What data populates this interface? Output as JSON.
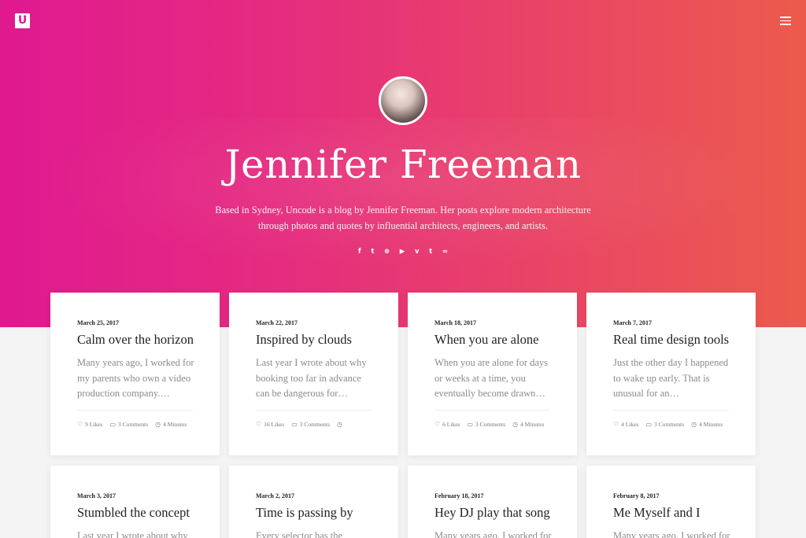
{
  "site": {
    "logo_letter": "U",
    "accent": "#e0198f",
    "gradient_end": "#ec5a4c"
  },
  "hero": {
    "name": "Jennifer Freeman",
    "bio_line1": "Based in Sydney, Uncode is a blog by Jennifer Freeman. Her posts explore modern architecture",
    "bio_line2": "through photos and quotes by influential architects, engineers, and artists.",
    "socials": [
      {
        "glyph": "f",
        "icon": "facebook-icon"
      },
      {
        "glyph": "t",
        "icon": "twitter-icon"
      },
      {
        "glyph": "⊛",
        "icon": "dribbble-icon"
      },
      {
        "glyph": "▶",
        "icon": "youtube-icon"
      },
      {
        "glyph": "v",
        "icon": "vimeo-icon"
      },
      {
        "glyph": "t",
        "icon": "tumblr-icon"
      },
      {
        "glyph": "∞",
        "icon": "link-icon"
      }
    ]
  },
  "posts": [
    {
      "date": "March 25, 2017",
      "title": "Calm over the horizon",
      "excerpt": [
        "Many years ago, I worked for",
        "my parents who own a video",
        "production company.…"
      ],
      "likes": "9 Likes",
      "comments": "3 Comments",
      "minutes": "4 Minutes"
    },
    {
      "date": "March 22, 2017",
      "title": "Inspired by clouds",
      "excerpt": [
        "Last year I wrote about why",
        "booking too far in advance",
        "can be dangerous for…"
      ],
      "likes": "16 Likes",
      "comments": "3 Comments",
      "minutes": ""
    },
    {
      "date": "March 18, 2017",
      "title": "When you are alone",
      "excerpt": [
        "When you are alone for days",
        "or weeks at a time, you",
        "eventually become drawn…"
      ],
      "likes": "6 Likes",
      "comments": "3 Comments",
      "minutes": "4 Minutes"
    },
    {
      "date": "March 7, 2017",
      "title": "Real time design tools",
      "excerpt": [
        "Just the other day I happened",
        "to wake up early. That is",
        "unusual for an…"
      ],
      "likes": "4 Likes",
      "comments": "3 Comments",
      "minutes": "4 Minutes"
    },
    {
      "date": "March 3, 2017",
      "title": "Stumbled the concept",
      "excerpt": [
        "Last year I wrote about why"
      ]
    },
    {
      "date": "March 2, 2017",
      "title": "Time is passing by",
      "excerpt": [
        "Every selector has the"
      ]
    },
    {
      "date": "February 18, 2017",
      "title": "Hey DJ play that song",
      "excerpt": [
        "Many years ago, I worked for"
      ]
    },
    {
      "date": "February 8, 2017",
      "title": "Me Myself and I",
      "excerpt": [
        "Many years ago, I worked for"
      ]
    }
  ]
}
